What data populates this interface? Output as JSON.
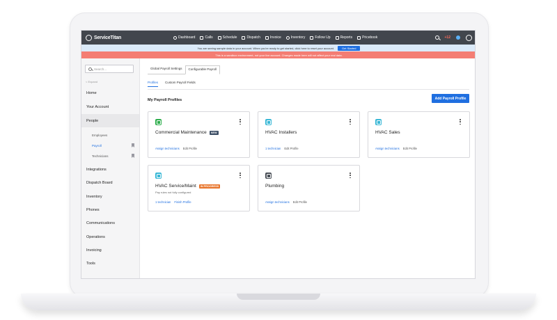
{
  "topnav": {
    "brand": "ServiceTitan",
    "items": [
      {
        "label": "Dashboard",
        "icon": "dashboard-icon"
      },
      {
        "label": "Calls",
        "icon": "phone-icon"
      },
      {
        "label": "Schedule",
        "icon": "calendar-icon"
      },
      {
        "label": "Dispatch",
        "icon": "dispatch-icon"
      },
      {
        "label": "Invoice",
        "icon": "invoice-icon"
      },
      {
        "label": "Inventory",
        "icon": "inventory-icon"
      },
      {
        "label": "Follow Up",
        "icon": "flag-icon"
      },
      {
        "label": "Reports",
        "icon": "reports-icon"
      },
      {
        "label": "Pricebook",
        "icon": "book-icon"
      }
    ],
    "notifications": "+12"
  },
  "banners": {
    "info": "You are seeing sample data in your account. When you're ready to get started, click here to reset your account.",
    "get_started": "Get Started",
    "warning": "This is a sandbox environment, not your live account. Changes made here will not affect your real data."
  },
  "sidebar": {
    "search_placeholder": "Search...",
    "expand": "< Expand",
    "items": [
      {
        "label": "Home"
      },
      {
        "label": "Your Account"
      },
      {
        "label": "People"
      }
    ],
    "subitems": [
      {
        "label": "Employees"
      },
      {
        "label": "Payroll"
      },
      {
        "label": "Technicians"
      }
    ],
    "items_after": [
      {
        "label": "Integrations"
      },
      {
        "label": "Dispatch Board"
      },
      {
        "label": "Inventory"
      },
      {
        "label": "Phones"
      },
      {
        "label": "Communications"
      },
      {
        "label": "Operations"
      },
      {
        "label": "Invoicing"
      },
      {
        "label": "Tools"
      }
    ]
  },
  "main": {
    "tabs": [
      {
        "label": "Global Payroll Settings"
      },
      {
        "label": "Configurable Payroll"
      }
    ],
    "subtabs": [
      {
        "label": "Profiles"
      },
      {
        "label": "Custom Payroll Fields"
      }
    ],
    "section_title": "My Payroll Profiles",
    "add_button": "Add Payroll Profile",
    "cards": [
      {
        "title": "Commercial Maintenance",
        "badge": "NEW",
        "badge_color": "#3d4f66",
        "icon_color": "#2fae4e",
        "note": "",
        "link": "Assign technicians",
        "edit": "Edit Profile"
      },
      {
        "title": "HVAC Installers",
        "badge": "",
        "badge_color": "",
        "icon_color": "#3ab8d6",
        "note": "",
        "link": "1 technician",
        "edit": "Edit Profile"
      },
      {
        "title": "HVAC Sales",
        "badge": "",
        "badge_color": "",
        "icon_color": "#3ab8d6",
        "note": "",
        "link": "Assign technicians",
        "edit": "Edit Profile"
      },
      {
        "title": "HVAC Service/Maint",
        "badge": "IN PROGRESS",
        "badge_color": "#e8762d",
        "icon_color": "#3ab8d6",
        "note": "Pay rules not fully configured",
        "link": "1 technician",
        "edit": "Finish Profile"
      },
      {
        "title": "Plumbing",
        "badge": "",
        "badge_color": "",
        "icon_color": "#4a4f57",
        "note": "",
        "link": "Assign technicians",
        "edit": "Edit Profile"
      }
    ]
  }
}
